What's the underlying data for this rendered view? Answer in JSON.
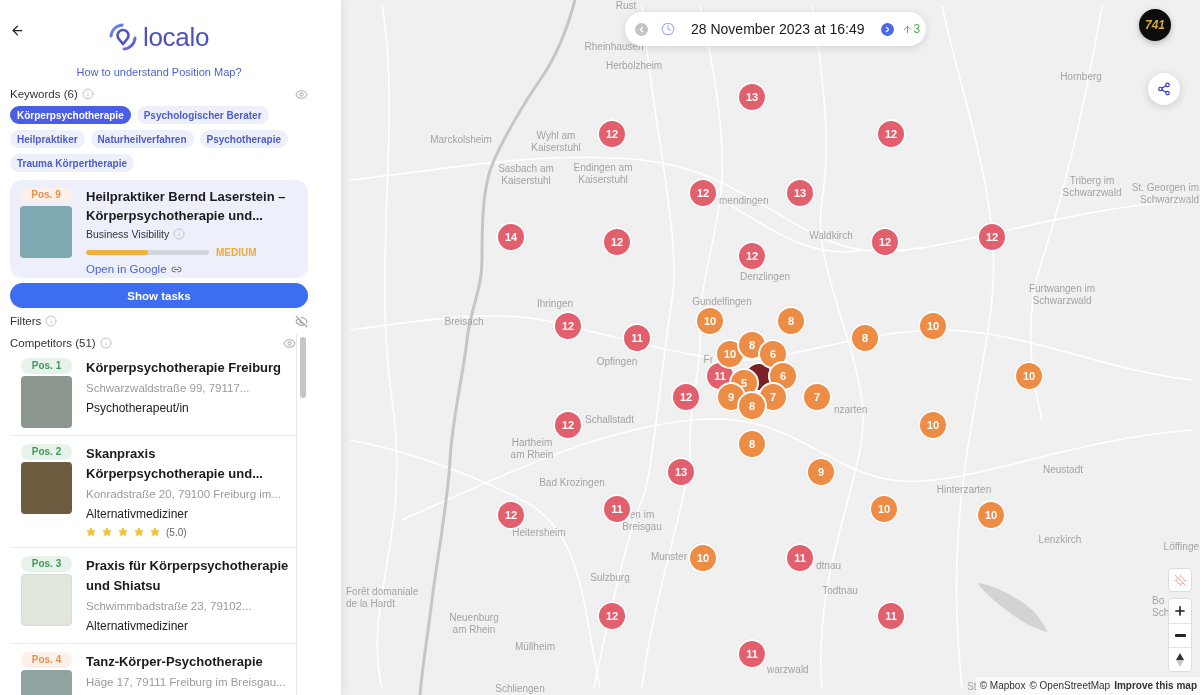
{
  "sidebar": {
    "logo": {
      "text": "localo"
    },
    "help_link": "How to understand Position Map?",
    "keywords": {
      "label": "Keywords (6)",
      "visible": true,
      "chips": [
        {
          "label": "Körperpsychotherapie",
          "selected": true
        },
        {
          "label": "Psychologischer Berater",
          "selected": false
        },
        {
          "label": "Heilpraktiker",
          "selected": false
        },
        {
          "label": "Naturheilverfahren",
          "selected": false
        },
        {
          "label": "Psychotherapie",
          "selected": false
        },
        {
          "label": "Trauma Körpertherapie",
          "selected": false
        }
      ]
    },
    "business": {
      "position": "Pos. 9",
      "color": "#e8914f",
      "title": "Heilpraktiker Bernd Laserstein – Körperpsychotherapie und...",
      "visibility": {
        "label": "Business Visibility",
        "level": 0.5,
        "rating": "MEDIUM"
      },
      "link": "Open in Google"
    },
    "show_tasks_button": "Show tasks",
    "filters": {
      "label": "Filters",
      "visible": false
    },
    "competitors": {
      "label": "Competitors (51)",
      "visible": true,
      "items": [
        {
          "position": "Pos. 1",
          "color": "#3f9a5b",
          "thumbnail": {
            "kind": "photo"
          },
          "title": "Körperpsychotherapie Freiburg",
          "address": "Schwarzwaldstraße 99, 79117...",
          "category": "Psychotherapeut/in"
        },
        {
          "position": "Pos. 2",
          "color": "#3f9a5b",
          "thumbnail": {
            "kind": "photo"
          },
          "title": "Skanpraxis Körperpsychotherapie und...",
          "address": "Konradstraße 20, 79100 Freiburg im...",
          "category": "Alternativmediziner",
          "stars": 5,
          "rating": "(5.0)"
        },
        {
          "position": "Pos. 3",
          "color": "#3f9a5b",
          "thumbnail": {
            "kind": "map"
          },
          "title": "Praxis für Körperpsychotherapie und Shiatsu",
          "address": "Schwimmbadstraße 23, 79102...",
          "category": "Alternativmediziner"
        },
        {
          "position": "Pos. 4",
          "color": "#e8914f",
          "thumbnail": {
            "kind": "photo"
          },
          "title": "Tanz-Körper-Psychotherapie",
          "address": "Häge 17, 79111 Freiburg im Breisgau..."
        }
      ]
    }
  },
  "map": {
    "date_bar": {
      "previous_button": {
        "disabled": true
      },
      "date": "28 November 2023 at 16:49",
      "next_button": {
        "disabled": false
      },
      "change": "3"
    },
    "account_badge": "741",
    "places": [
      {
        "label": "Rust"
      },
      {
        "label": "Rheinhausen"
      },
      {
        "label": "Herbolzheim"
      },
      {
        "label": "Hornberg"
      },
      {
        "label": "Marckolsheim"
      },
      {
        "label": "Wyhl am\nKaiserstuhl"
      },
      {
        "label": "Sasbach am\nKaiserstuhl"
      },
      {
        "label": "Endingen am\nKaiserstuhl"
      },
      {
        "label": "mendingen"
      },
      {
        "label": "Triberg im\nSchwarzwald"
      },
      {
        "label": "St. Georgen im\nSchwarzwald"
      },
      {
        "label": "Waldkirch"
      },
      {
        "label": "Denzlingen"
      },
      {
        "label": "Ihringen"
      },
      {
        "label": "Gundelfingen"
      },
      {
        "label": "Furtwangen im\nSchwarzwald"
      },
      {
        "label": "Breisach"
      },
      {
        "label": "Opfingen"
      },
      {
        "label": "Fr"
      },
      {
        "label": "Schallstadt"
      },
      {
        "label": "nzarten"
      },
      {
        "label": "Hartheim\nam Rhein"
      },
      {
        "label": "Neustadt"
      },
      {
        "label": "Bad Krozingen"
      },
      {
        "label": "Hinterzarten"
      },
      {
        "label": "Heitersheim"
      },
      {
        "label": "en im\nBreisgau"
      },
      {
        "label": "Lenzkirch"
      },
      {
        "label": "Löffinge"
      },
      {
        "label": "Munster"
      },
      {
        "label": "dtnau"
      },
      {
        "label": "Sulzburg"
      },
      {
        "label": "Todtnau"
      },
      {
        "label": "Forêt domaniale\nde la Hardt"
      },
      {
        "label": "Bo\nSch"
      },
      {
        "label": "Neuenburg\nam Rhein"
      },
      {
        "label": "Müllheim"
      },
      {
        "label": "warzwald"
      },
      {
        "label": "Schliengen"
      },
      {
        "label": "St."
      }
    ],
    "markers": [
      {
        "value": "13",
        "color": "#e2606d"
      },
      {
        "value": "12",
        "color": "#e2606d"
      },
      {
        "value": "12",
        "color": "#e2606d"
      },
      {
        "value": "12",
        "color": "#e2606d"
      },
      {
        "value": "13",
        "color": "#e2606d"
      },
      {
        "value": "14",
        "color": "#e2606d"
      },
      {
        "value": "12",
        "color": "#e2606d"
      },
      {
        "value": "12",
        "color": "#e2606d"
      },
      {
        "value": "12",
        "color": "#e2606d"
      },
      {
        "value": "12",
        "color": "#e2606d"
      },
      {
        "value": "10",
        "color": "#ec8c45"
      },
      {
        "value": "8",
        "color": "#ec8c45"
      },
      {
        "value": "12",
        "color": "#e2606d"
      },
      {
        "value": "11",
        "color": "#e2606d"
      },
      {
        "value": "8",
        "color": "#ec8c45"
      },
      {
        "value": "10",
        "color": "#ec8c45"
      },
      {
        "value": "10",
        "color": "#ec8c45"
      },
      {
        "value": "12",
        "color": "#e2606d"
      },
      {
        "value": "7",
        "color": "#ec8c45"
      },
      {
        "value": "12",
        "color": "#e2606d"
      },
      {
        "value": "10",
        "color": "#ec8c45"
      },
      {
        "value": "8",
        "color": "#ec8c45"
      },
      {
        "value": "13",
        "color": "#e2606d"
      },
      {
        "value": "9",
        "color": "#ec8c45"
      },
      {
        "value": "11",
        "color": "#e2606d"
      },
      {
        "value": "12",
        "color": "#e2606d"
      },
      {
        "value": "10",
        "color": "#ec8c45"
      },
      {
        "value": "10",
        "color": "#ec8c45"
      },
      {
        "value": "10",
        "color": "#ec8c45"
      },
      {
        "value": "11",
        "color": "#e2606d"
      },
      {
        "value": "12",
        "color": "#e2606d"
      },
      {
        "value": "11",
        "color": "#e2606d"
      },
      {
        "value": "11",
        "color": "#e2606d"
      },
      {
        "color": "#7c1f27"
      },
      {
        "value": "11",
        "color": "#e2606d"
      },
      {
        "value": "10",
        "color": "#ec8c45"
      },
      {
        "value": "8",
        "color": "#ec8c45"
      },
      {
        "value": "6",
        "color": "#ec8c45"
      },
      {
        "value": "6",
        "color": "#ec8c45"
      },
      {
        "value": "5",
        "color": "#ec8c45"
      },
      {
        "value": "9",
        "color": "#ec8c45"
      },
      {
        "value": "7",
        "color": "#ec8c45"
      },
      {
        "value": "8",
        "color": "#ec8c45"
      }
    ],
    "attribution": {
      "mapbox": "© Mapbox",
      "osm": "© OpenStreetMap",
      "improve": "Improve this map"
    }
  }
}
